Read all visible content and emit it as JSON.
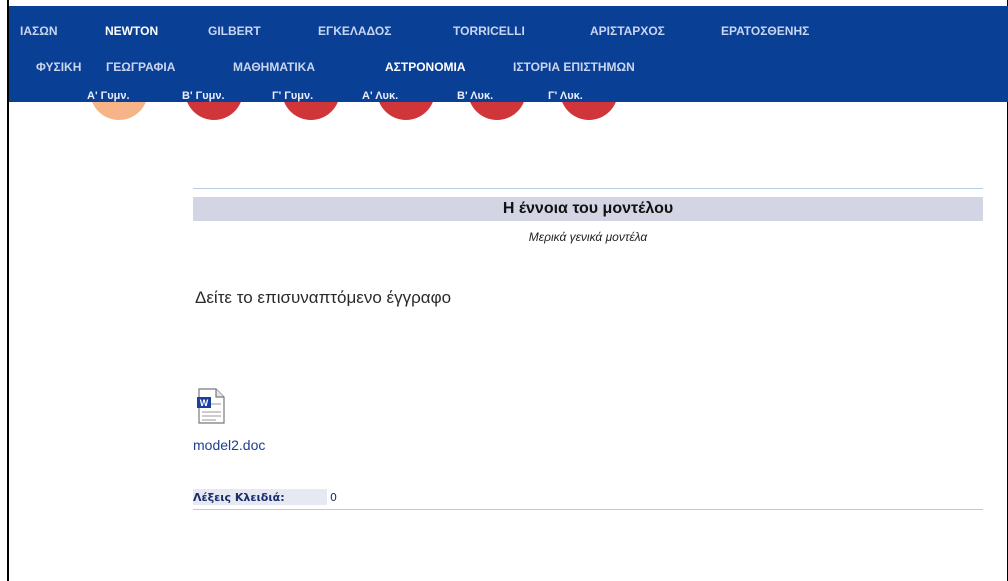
{
  "top_nav": {
    "items": [
      {
        "label": "ΙΑΣΩΝ",
        "active": false
      },
      {
        "label": "NEWTON",
        "active": true
      },
      {
        "label": "GILBERT",
        "active": false
      },
      {
        "label": "ΕΓΚΕΛΑΔΟΣ",
        "active": false
      },
      {
        "label": "TORRICELLI",
        "active": false
      },
      {
        "label": "ΑΡΙΣΤΑΡΧΟΣ",
        "active": false
      },
      {
        "label": "ΕΡΑΤΟΣΘΕΝΗΣ",
        "active": false
      }
    ]
  },
  "subject_nav": {
    "items": [
      {
        "label": "ΦΥΣΙΚΗ",
        "active": false
      },
      {
        "label": "ΓΕΩΓΡΑΦΙΑ",
        "active": false
      },
      {
        "label": "ΜΑΘΗΜΑΤΙΚΑ",
        "active": false
      },
      {
        "label": "ΑΣΤΡΟΝΟΜΙΑ",
        "active": true
      },
      {
        "label": "ΙΣΤΟΡΙΑ ΕΠΙΣΤΗΜΩΝ",
        "active": false
      }
    ]
  },
  "grade_nav": {
    "items": [
      {
        "label": "Α' Γυμν.",
        "active": true
      },
      {
        "label": "Β' Γυμν.",
        "active": false
      },
      {
        "label": "Γ' Γυμν.",
        "active": false
      },
      {
        "label": "Α' Λυκ.",
        "active": false
      },
      {
        "label": "Β' Λυκ.",
        "active": false
      },
      {
        "label": "Γ' Λυκ.",
        "active": false
      }
    ]
  },
  "article": {
    "title": "Η έννοια του μοντέλου",
    "subtitle": "Μερικά γενικά μοντέλα",
    "body": "Δείτε το επισυναπτόμενο έγγραφο",
    "attachment": {
      "filename": "model2.doc",
      "icon": "word-document-icon"
    },
    "keywords_label": "Λέξεις Κλειδιά:",
    "keywords_value": "0"
  },
  "colors": {
    "nav_bg": "#0a3f96",
    "circle_active": "#f6b488",
    "circle_inactive": "#d0353a",
    "title_band": "#d3d5e4",
    "link": "#1f3e8c"
  }
}
